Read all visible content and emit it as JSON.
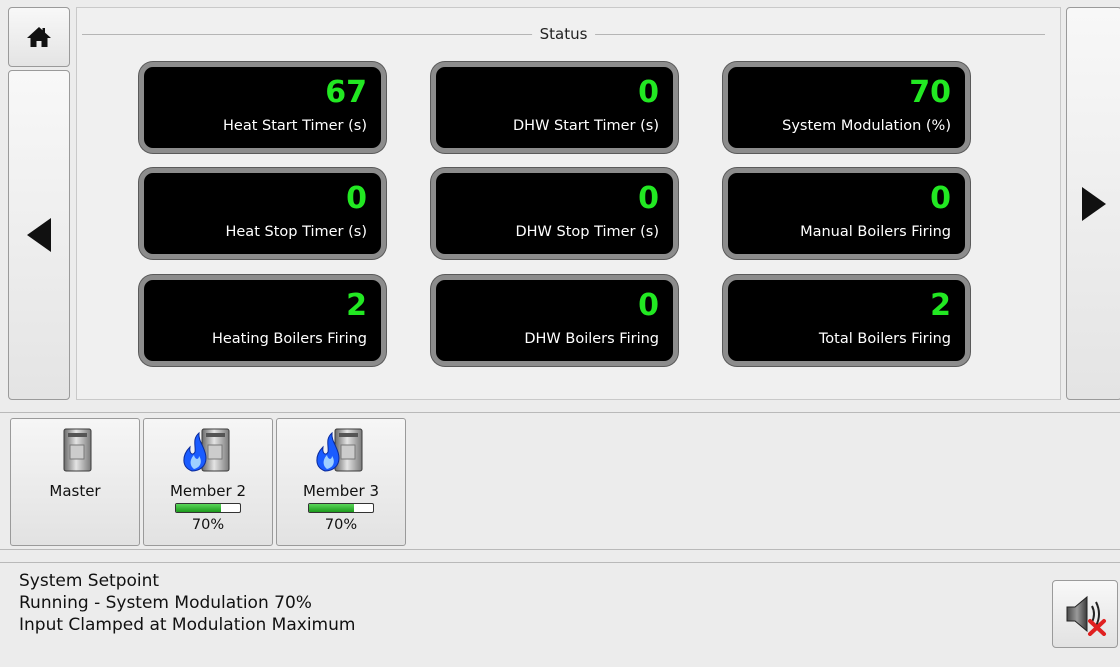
{
  "status_section": {
    "title": "Status",
    "tiles": [
      {
        "value": "67",
        "label": "Heat Start Timer (s)"
      },
      {
        "value": "0",
        "label": "DHW Start Timer (s)"
      },
      {
        "value": "70",
        "label": "System Modulation (%)"
      },
      {
        "value": "0",
        "label": "Heat Stop Timer (s)"
      },
      {
        "value": "0",
        "label": "DHW Stop Timer (s)"
      },
      {
        "value": "0",
        "label": "Manual Boilers Firing"
      },
      {
        "value": "2",
        "label": "Heating Boilers Firing"
      },
      {
        "value": "0",
        "label": "DHW Boilers Firing"
      },
      {
        "value": "2",
        "label": "Total Boilers Firing"
      }
    ]
  },
  "boilers": [
    {
      "name": "Master",
      "firing": false
    },
    {
      "name": "Member 2",
      "firing": true,
      "modulation": 0.7,
      "modulation_label": "70%"
    },
    {
      "name": "Member 3",
      "firing": true,
      "modulation": 0.7,
      "modulation_label": "70%"
    }
  ],
  "status_lines": [
    "System Setpoint",
    "Running - System Modulation 70%",
    "Input Clamped at Modulation Maximum"
  ],
  "icons": {
    "home": "home-icon",
    "prev": "arrow-left-icon",
    "next": "arrow-right-icon",
    "boiler": "boiler-icon",
    "flame": "flame-icon",
    "mute": "speaker-muted-icon"
  },
  "colors": {
    "tile_value": "#22e822",
    "tile_background": "#000000",
    "tile_border": "#8c8c8c",
    "bar_fill": "#2fb82f",
    "flame": "#1a5cff",
    "mute_x": "#e02020"
  }
}
